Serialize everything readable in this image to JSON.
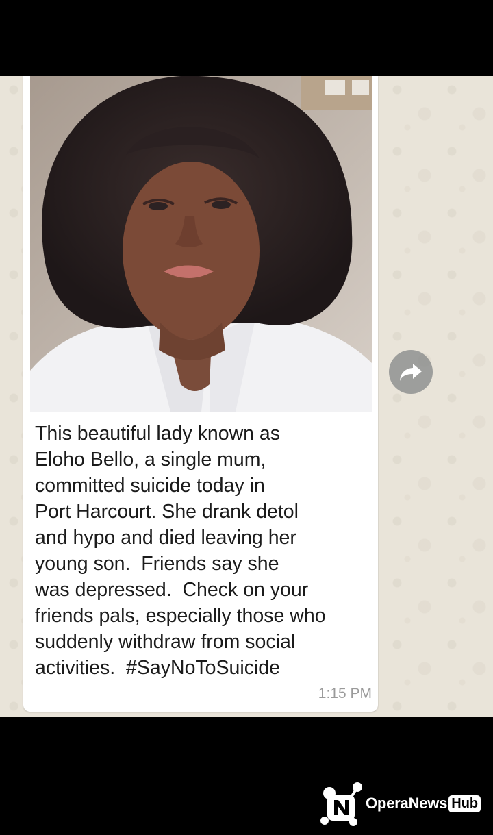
{
  "message": {
    "photo": {
      "alt": "Photo of a woman with curly hair wearing a white shirt",
      "icon": "photo"
    },
    "caption": "This beautiful lady known as\nEloho Bello, a single mum,\ncommitted suicide today in\nPort Harcourt. She drank detol\nand hypo and died leaving her\nyoung son.  Friends say she\nwas depressed.  Check on your\nfriends pals, especially those who\nsuddenly withdraw from social\nactivities.  #SayNoToSuicide",
    "time": "1:15 PM"
  },
  "forward_button": {
    "icon": "forward-arrow-icon"
  },
  "watermark": {
    "brand": "OperaNews",
    "badge": "Hub"
  },
  "colors": {
    "chat_background": "#e9e4d9",
    "bubble": "#ffffff",
    "caption_text": "#1b1b1b",
    "timestamp": "#9a9a9a"
  }
}
